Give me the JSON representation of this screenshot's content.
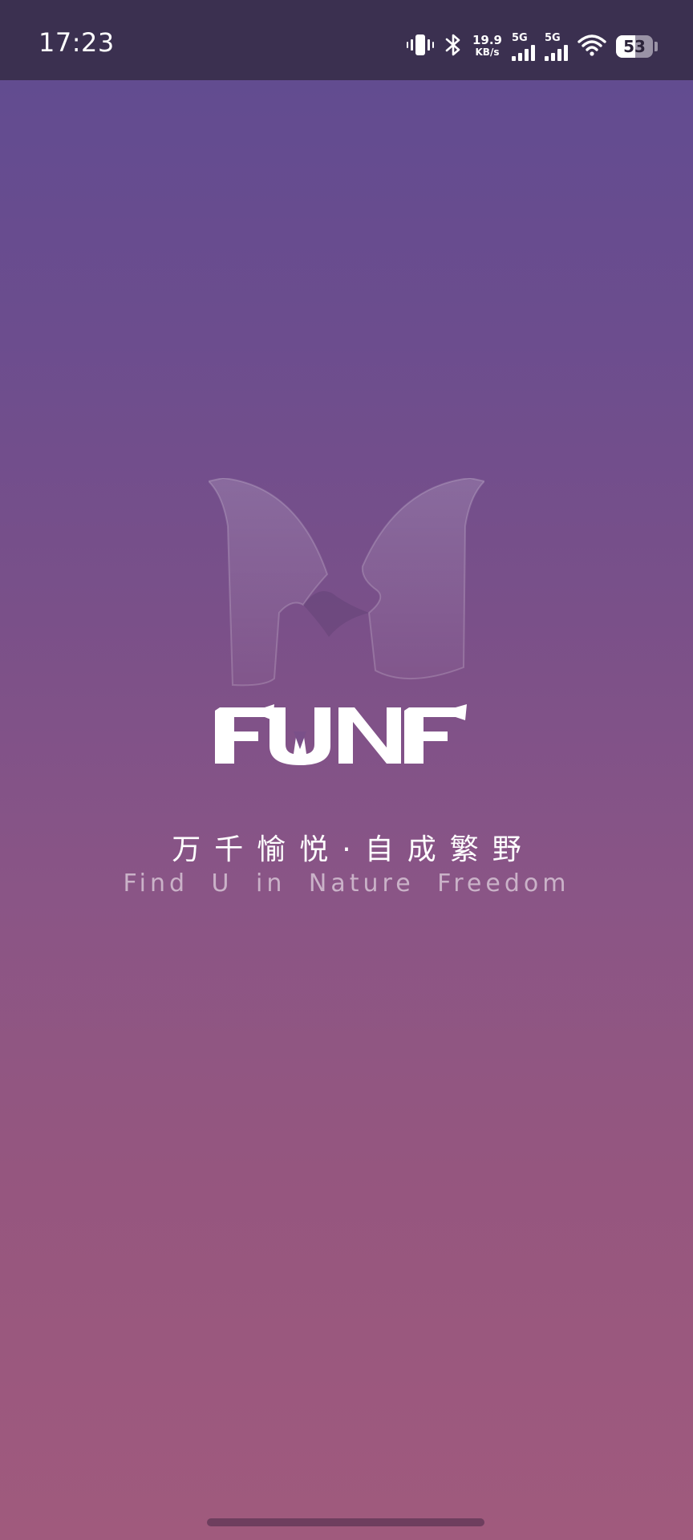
{
  "status_bar": {
    "time": "17:23",
    "net_speed_value": "19.9",
    "net_speed_unit": "KB/s",
    "sim1_label": "5G",
    "sim2_label": "5G",
    "battery_level": "53",
    "icons": [
      "vibrate-icon",
      "bluetooth-icon",
      "signal-icon",
      "signal-icon",
      "wifi-icon",
      "battery-icon"
    ]
  },
  "splash": {
    "brand": "FUNF",
    "slogan_cn": "万千愉悦·自成繁野",
    "slogan_en": "Find U in Nature Freedom"
  },
  "colors": {
    "status_bar_bg": "#3b3050",
    "gradient_top": "#5f4b91",
    "gradient_bottom": "#a05a7d",
    "text": "#ffffff"
  }
}
